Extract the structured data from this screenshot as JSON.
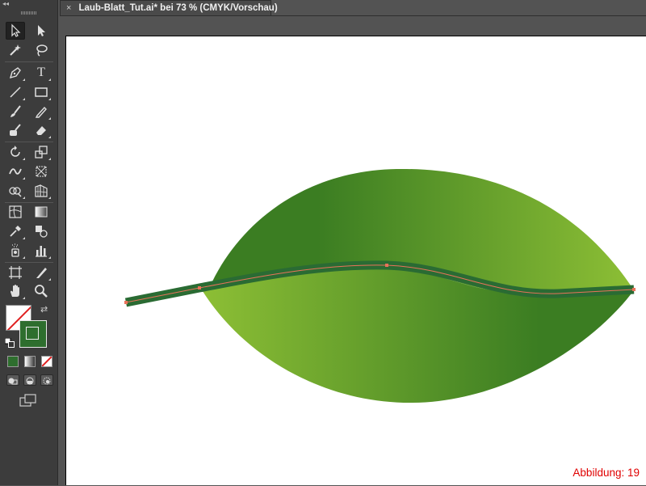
{
  "app": {
    "collapse_label": "◂◂",
    "document_tab": {
      "close_label": "×",
      "title": "Laub-Blatt_Tut.ai* bei 73 % (CMYK/Vorschau)"
    }
  },
  "toolbox": {
    "tools": [
      "selection-tool",
      "direct-selection-tool",
      "magic-wand-tool",
      "lasso-tool",
      "pen-tool",
      "type-tool",
      "line-segment-tool",
      "rectangle-tool",
      "paintbrush-tool",
      "pencil-tool",
      "blob-brush-tool",
      "eraser-tool",
      "rotate-tool",
      "scale-tool",
      "width-tool",
      "free-transform-tool",
      "shape-builder-tool",
      "perspective-grid-tool",
      "mesh-tool",
      "gradient-tool",
      "eyedropper-tool",
      "blend-tool",
      "symbol-sprayer-tool",
      "column-graph-tool",
      "artboard-tool",
      "slice-tool",
      "hand-tool",
      "zoom-tool"
    ],
    "type_tool_glyph": "T",
    "fill": {
      "color": "none"
    },
    "stroke": {
      "color": "#2e6e2e"
    }
  },
  "artwork": {
    "leaf_gradient_dark": "#3b7d22",
    "leaf_gradient_light": "#8dbf35",
    "stem_color": "#2a6b33",
    "path_color": "#e8735a"
  },
  "caption": "Abbildung: 19"
}
